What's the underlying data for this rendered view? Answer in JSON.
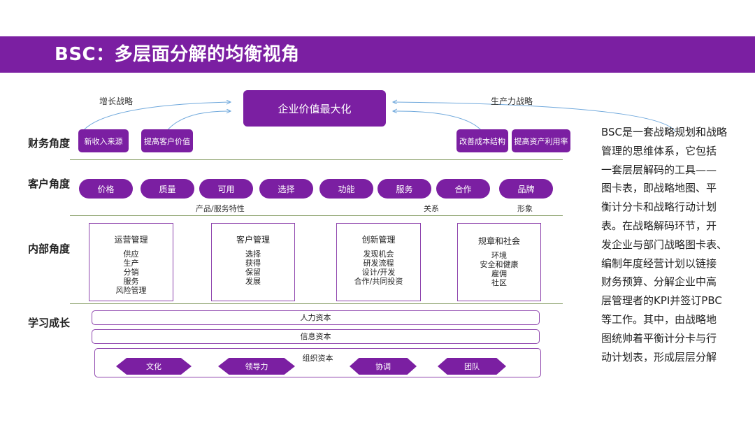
{
  "header": {
    "title": "BSC：多层面分解的均衡视角"
  },
  "top": {
    "center": "企业价值最大化",
    "left_strategy": "增长战略",
    "right_strategy": "生产力战略"
  },
  "rows": {
    "finance": "财务角度",
    "customer": "客户角度",
    "internal": "内部角度",
    "learning": "学习成长"
  },
  "finance_boxes": [
    "新收入来源",
    "提高客户价值",
    "改善成本结构",
    "提高资产利用率"
  ],
  "customer_pills": [
    "价格",
    "质量",
    "可用",
    "选择",
    "功能",
    "服务",
    "合作",
    "品牌"
  ],
  "customer_groups": [
    "产品/服务特性",
    "关系",
    "形象"
  ],
  "internal_boxes": [
    {
      "title": "运营管理",
      "items": [
        "供应",
        "生产",
        "分销",
        "服务",
        "风险管理"
      ]
    },
    {
      "title": "客户管理",
      "items": [
        "选择",
        "获得",
        "保留",
        "发展"
      ]
    },
    {
      "title": "创新管理",
      "items": [
        "发现机会",
        "研发流程",
        "设计/开发",
        "合作/共同投资"
      ]
    },
    {
      "title": "规章和社会",
      "items": [
        "环境",
        "安全和健康",
        "雇佣",
        "社区"
      ]
    }
  ],
  "learning_capitals": [
    "人力资本",
    "信息资本",
    "组织资本"
  ],
  "org_elements": [
    "文化",
    "领导力",
    "协调",
    "团队"
  ],
  "side_text_lines": [
    "BSC是一套战略规划和战略",
    "管理的思维体系，它包括",
    "一套层层解码的工具——",
    "图卡表，即战略地图、平",
    "衡计分卡和战略行动计划",
    "表。在战略解码环节，开",
    "发企业与部门战略图卡表、",
    "编制年度经营计划以链接",
    "财务预算、分解企业中高",
    "层管理者的KPI并签订PBC",
    "等工作。其中，由战略地",
    "图统帅着平衡计分卡与行",
    "动计划表，形成层层分解"
  ],
  "colors": {
    "accent": "#7b1fa2",
    "border": "#8e44ad",
    "arrow": "#6fa8dc",
    "divider": "#8aa06a"
  }
}
